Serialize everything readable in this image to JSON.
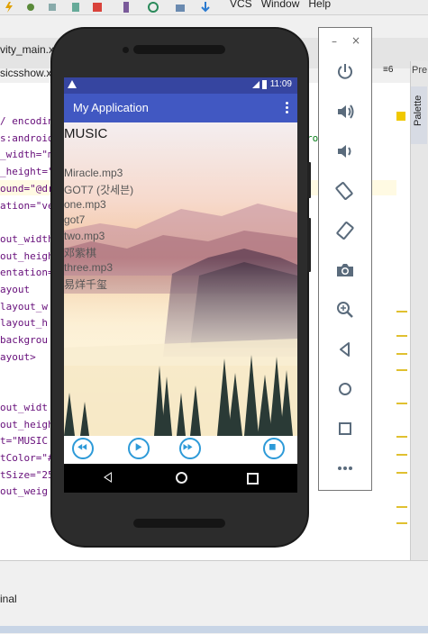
{
  "ide": {
    "menu": [
      "VCS",
      "Window",
      "Help"
    ],
    "tabs": [
      "vity_main.xn",
      "sicsshow.x"
    ],
    "right_tab": "Pre",
    "palette_label": "Palette",
    "tab_counter": "≡6",
    "code_lines": [
      {
        "attr": "/ encodin",
        "rest": ""
      },
      {
        "attr": "s:android",
        "rest": ""
      },
      {
        "attr": "_width=\"m",
        "rest": ""
      },
      {
        "attr": "_height=\"",
        "rest": ""
      },
      {
        "attr": "ound=\"@dr",
        "rest": ""
      },
      {
        "attr": "ation=\"ve",
        "rest": ""
      },
      {
        "attr": "",
        "rest": ""
      },
      {
        "attr": "out_width",
        "rest": ""
      },
      {
        "attr": "out_heigh",
        "rest": ""
      },
      {
        "attr": "entation=",
        "rest": ""
      },
      {
        "attr": "ayout",
        "rest": ""
      },
      {
        "attr": "layout_w",
        "rest": ""
      },
      {
        "attr": "layout_h",
        "rest": ""
      },
      {
        "attr": "backgrou",
        "rest": ""
      },
      {
        "attr": "ayout>",
        "rest": ""
      },
      {
        "attr": "",
        "rest": ""
      },
      {
        "attr": "",
        "rest": ""
      },
      {
        "attr": "out_widt",
        "rest": ""
      },
      {
        "attr": "out_heigh",
        "rest": ""
      },
      {
        "attr": "t=\"MUSIC",
        "rest": ""
      },
      {
        "attr": "tColor=\"#",
        "rest": ""
      },
      {
        "attr": "tSize=\"25",
        "rest": ""
      },
      {
        "attr": "out_weig",
        "rest": ""
      }
    ],
    "right_code": "ro",
    "terminal_label": "inal"
  },
  "emulator": {
    "status_time": "11:09",
    "app_title": "My Application",
    "heading": "MUSIC",
    "songs": [
      "Miracle.mp3",
      "GOT7 (갓세븐)",
      "one.mp3",
      "got7",
      "two.mp3",
      "邓紫棋",
      "three.mp3",
      "易烊千玺"
    ],
    "controls": [
      "rewind",
      "play",
      "fast-forward",
      "stop"
    ]
  },
  "emulator_panel": {
    "minimize": "–",
    "close": "×",
    "tools": [
      "power",
      "volume-up",
      "volume-down",
      "rotate-left",
      "rotate-right",
      "screenshot",
      "zoom",
      "back",
      "home",
      "overview",
      "more"
    ]
  },
  "colors": {
    "statusbar": "#3645a0",
    "appbar": "#4158c2",
    "control_accent": "#2d9ad8",
    "emu_icon": "#5a6b7c"
  }
}
